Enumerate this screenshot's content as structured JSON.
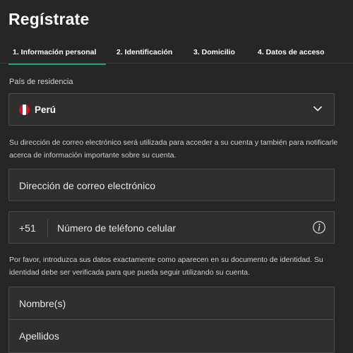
{
  "page": {
    "title": "Regístrate"
  },
  "steps": [
    {
      "label": "1. Información personal",
      "active": true
    },
    {
      "label": "2. Identificación",
      "active": false
    },
    {
      "label": "3. Domicilio",
      "active": false
    },
    {
      "label": "4. Datos de acceso",
      "active": false
    }
  ],
  "country": {
    "label": "País de residencia",
    "selected": "Perú",
    "flag_colors": [
      "#d91023",
      "#ffffff",
      "#d91023"
    ]
  },
  "email": {
    "help": "Su dirección de correo electrónico será utilizada para acceder a su cuenta y también para notificarle acerca de información importante sobre su cuenta.",
    "placeholder": "Dirección de correo electrónico"
  },
  "phone": {
    "prefix": "+51",
    "placeholder": "Número de teléfono celular",
    "icon": "info-icon"
  },
  "identity": {
    "help": "Por favor, introduzca sus datos exactamente como aparecen en su documento de identidad. Su identidad debe ser verificada para que pueda seguir utilizando su cuenta.",
    "first_name_placeholder": "Nombre(s)",
    "last_name_placeholder": "Apellidos"
  },
  "colors": {
    "background": "#262626",
    "field": "#2f2f2f",
    "accent": "#1fa36b"
  }
}
